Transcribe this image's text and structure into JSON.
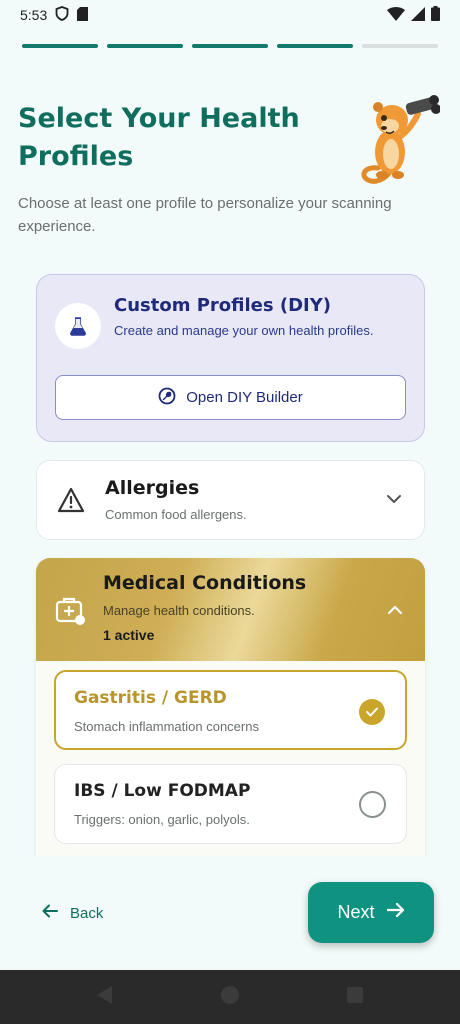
{
  "status_bar": {
    "time": "5:53",
    "icons": [
      "shield-icon",
      "sim-card-icon",
      "wifi-icon",
      "signal-icon",
      "battery-icon"
    ]
  },
  "progress": {
    "completed_steps": 4,
    "total_steps": 5
  },
  "header": {
    "title": "Select Your Health Profiles",
    "subtitle": "Choose at least one profile to personalize your scanning experience.",
    "mascot": "meerkat-with-binoculars"
  },
  "diy": {
    "title": "Custom Profiles (DIY)",
    "description": "Create and manage your own health profiles.",
    "button_label": "Open DIY Builder",
    "icon": "flask-icon",
    "button_icon": "wrench-icon"
  },
  "allergies": {
    "title": "Allergies",
    "description": "Common food allergens.",
    "icon": "warning-icon",
    "expanded": false
  },
  "medical": {
    "title": "Medical Conditions",
    "description": "Manage health conditions.",
    "active_text": "1 active",
    "icon": "medical-kit-icon",
    "expanded": true,
    "options": [
      {
        "title": "Gastritis / GERD",
        "description": "Stomach inflammation concerns",
        "selected": true
      },
      {
        "title": "IBS / Low FODMAP",
        "description": "Triggers: onion, garlic, polyols.",
        "selected": false
      }
    ]
  },
  "footer": {
    "back_label": "Back",
    "next_label": "Next"
  },
  "colors": {
    "primary": "#0f6e5e",
    "button": "#0f9380",
    "gold": "#c9a52c",
    "diy_bg": "#e8e8f6",
    "diy_text": "#1f2a7a"
  }
}
